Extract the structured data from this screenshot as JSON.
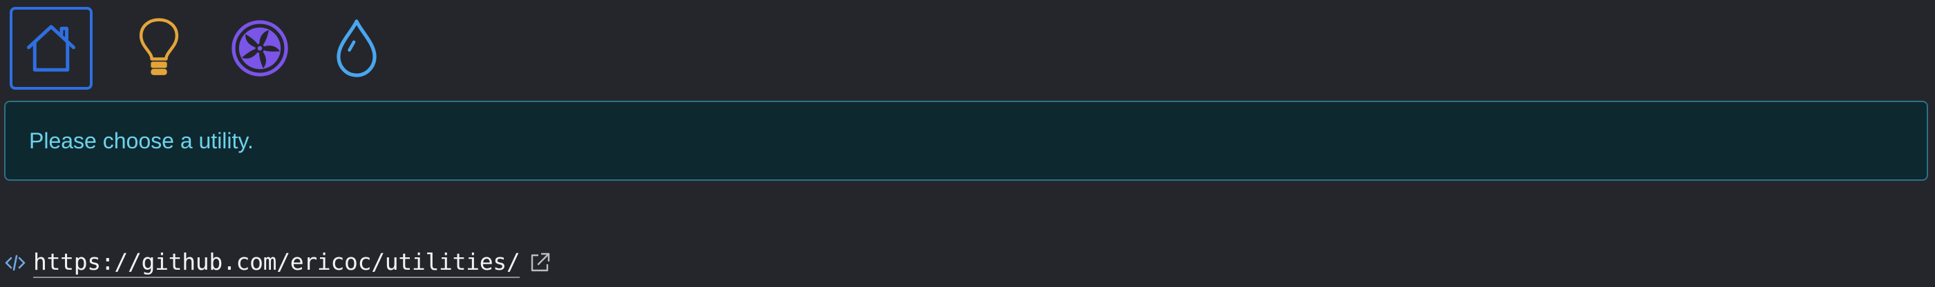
{
  "nav": {
    "items": [
      {
        "id": "home",
        "icon": "house-icon",
        "color": "#2f6fe0",
        "active": true
      },
      {
        "id": "electricity",
        "icon": "lightbulb-icon",
        "color": "#e3a53a",
        "active": false
      },
      {
        "id": "ventilation",
        "icon": "fan-icon",
        "color": "#7b54e8",
        "active": false
      },
      {
        "id": "water",
        "icon": "water-drop-icon",
        "color": "#4aa6ee",
        "active": false
      }
    ]
  },
  "alert": {
    "message": "Please choose a utility.",
    "background": "#0e2830",
    "border": "#2b7384",
    "text_color": "#6ed3ea"
  },
  "footer": {
    "code_icon": "code-icon",
    "link_text": "https://github.com/ericoc/utilities/",
    "link_href": "https://github.com/ericoc/utilities/",
    "external_icon": "external-link-icon"
  }
}
